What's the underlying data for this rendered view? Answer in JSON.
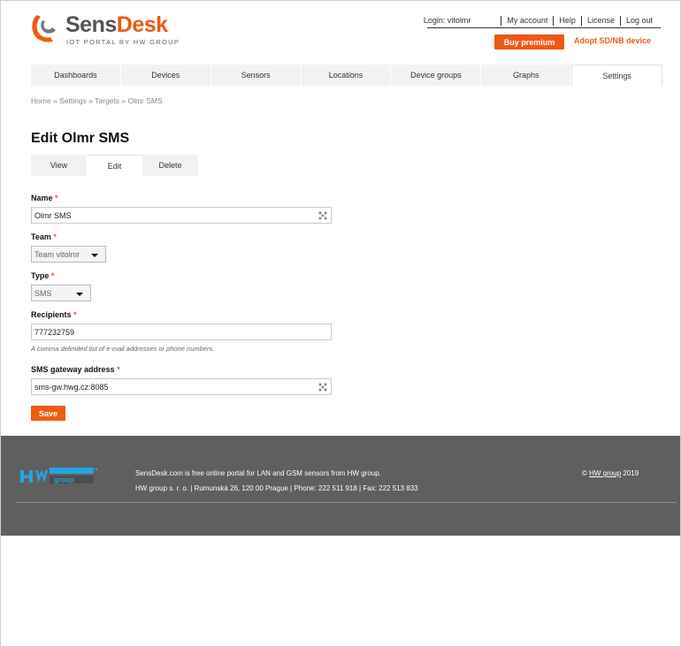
{
  "brand": {
    "name_part1": "Sens",
    "name_part2": "Desk",
    "tagline": "IOT PORTAL BY HW GROUP",
    "accent_color": "#ee5a12"
  },
  "top_links": {
    "login": "Login: vitolmr",
    "my_account": "My account",
    "help": "Help",
    "license": "License",
    "logout": "Log out"
  },
  "buy_premium": "Buy premium",
  "adopt_device": "Adopt SD/NB device",
  "nav": [
    {
      "label": "Dashboards",
      "active": false
    },
    {
      "label": "Devices",
      "active": false
    },
    {
      "label": "Sensors",
      "active": false
    },
    {
      "label": "Locations",
      "active": false
    },
    {
      "label": "Device groups",
      "active": false
    },
    {
      "label": "Graphs",
      "active": false
    },
    {
      "label": "Settings",
      "active": true
    }
  ],
  "breadcrumb": "Home » Settings » Targets » Olmr SMS",
  "page_title": "Edit Olmr SMS",
  "tabs": [
    {
      "label": "View",
      "active": false
    },
    {
      "label": "Edit",
      "active": true
    },
    {
      "label": "Delete",
      "active": false
    }
  ],
  "form": {
    "required_mark": "*",
    "name": {
      "label": "Name",
      "value": "Olmr SMS"
    },
    "team": {
      "label": "Team",
      "value": "Team vitolmr"
    },
    "type": {
      "label": "Type",
      "value": "SMS"
    },
    "recipients": {
      "label": "Recipients",
      "value": "777232759",
      "hint": "A comma delimited list of e-mail addresses or phone numbers."
    },
    "gateway": {
      "label": "SMS gateway address",
      "value": "sms-gw.hwg.cz:8085"
    },
    "save": "Save"
  },
  "footer": {
    "logo": "hw-group-logo",
    "line1": "SensDesk.com is free online portal for LAN and GSM sensors from HW group.",
    "line2": "HW group s. r. o. | Rumunská 26, 120 00 Prague | Phone: 222 511 918 | Fax: 222 513 833",
    "copyright_prefix": "© ",
    "copyright_link": "HW group",
    "copyright_year": " 2019"
  }
}
